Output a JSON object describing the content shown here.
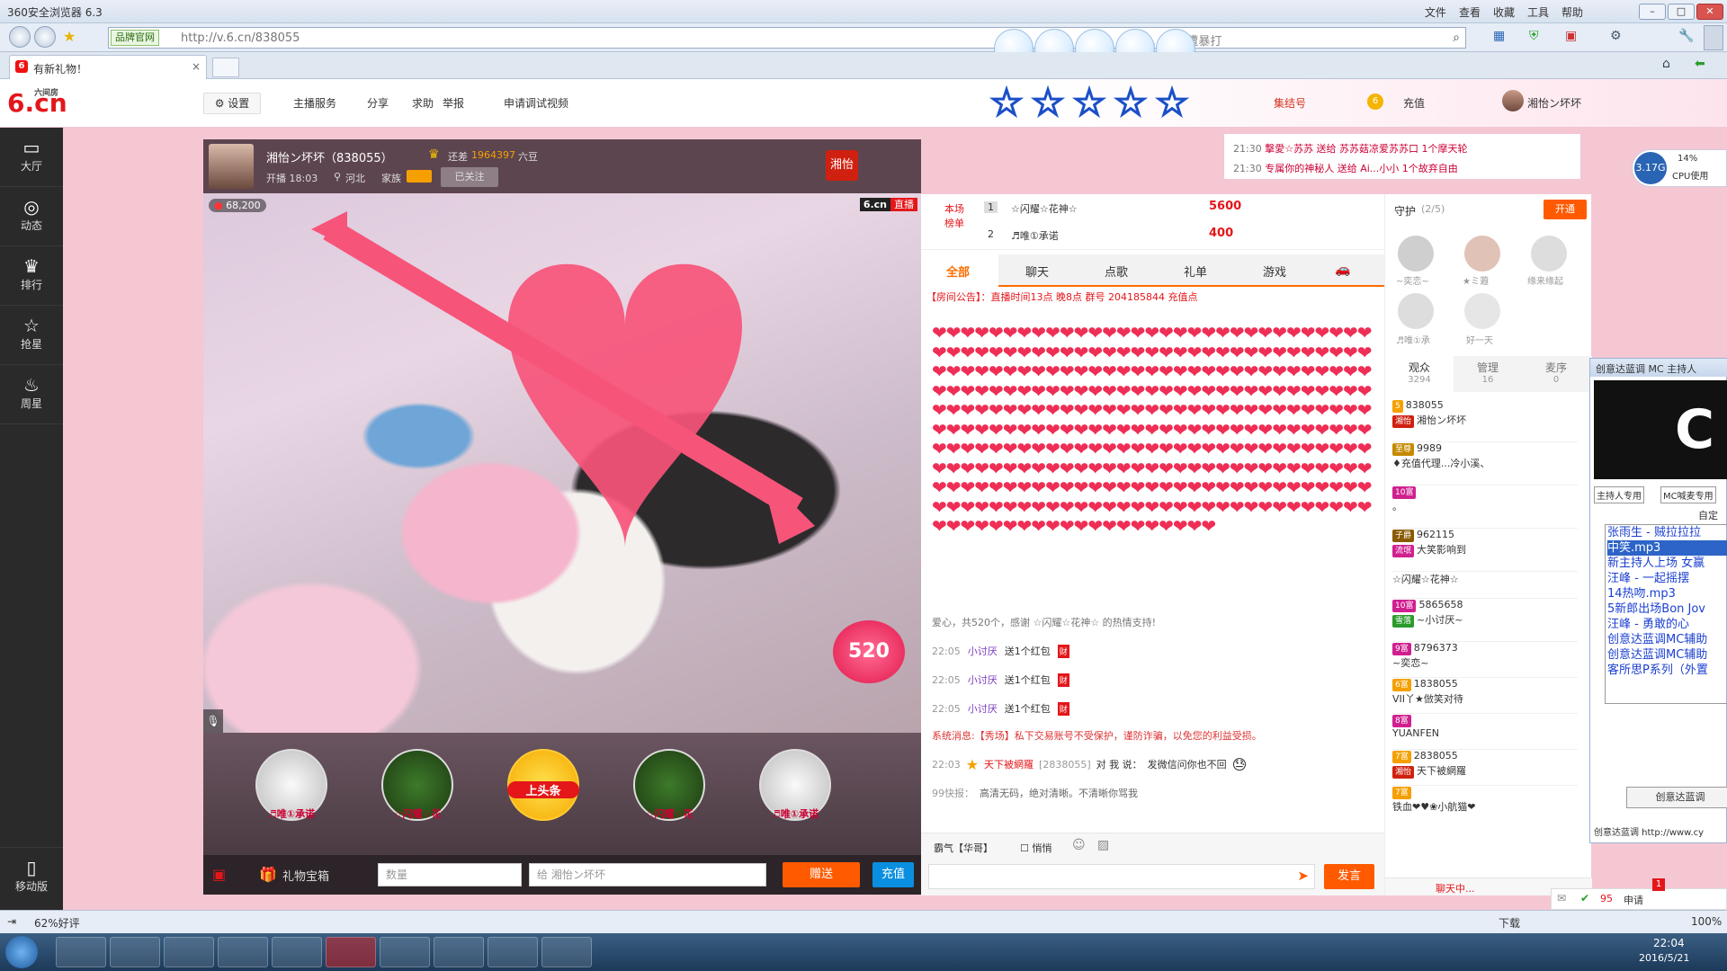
{
  "browser": {
    "title": "360安全浏览器 6.3",
    "menu": [
      "文件",
      "查看",
      "收藏",
      "工具",
      "帮助"
    ],
    "site_tag": "品牌官网",
    "url": "http://v.6.cn/838055",
    "search_text": "...老师遭暴打",
    "tab_label": "有新礼物！",
    "tab_close": "×"
  },
  "site": {
    "logo": "6.cn",
    "logo_sub": "六间房",
    "settings": "设置",
    "nav": [
      "主播服务",
      "分享",
      "求助",
      "举报",
      "申请调试视频"
    ],
    "stars": [
      "★",
      "★",
      "★",
      "★",
      "★"
    ],
    "right_links": [
      "集结号",
      "充值"
    ],
    "user_name": "湘怡ン坏坏"
  },
  "leftnav": [
    {
      "icon": "▭",
      "label": "大厅"
    },
    {
      "icon": "◎",
      "label": "动态"
    },
    {
      "icon": "♛",
      "label": "排行"
    },
    {
      "icon": "☆",
      "label": "抢星"
    },
    {
      "icon": "♨",
      "label": "周星"
    }
  ],
  "leftnav_bottom": "移动版",
  "streamer": {
    "name": "湘怡ン坏坏（838055）",
    "still_short": "还差",
    "beans": "1964397",
    "beans_unit": "六豆",
    "start": "开播 18:03",
    "location": "河北",
    "family": "家族",
    "follow": "已关注",
    "flag": "湘怡",
    "viewers": "68,200",
    "badge": "6.cn",
    "badge_live": "直播",
    "big_heart": "520"
  },
  "gifts": [
    {
      "label": "♬唯①承诺"
    },
    {
      "label": "☆闪耀☆花"
    },
    {
      "label": "上头条"
    },
    {
      "label": "☆闪耀☆花"
    },
    {
      "label": "♬唯①承诺"
    }
  ],
  "giftbar": {
    "box": "礼物宝箱",
    "qty": "数量",
    "to": "给 湘怡ン坏坏",
    "send": "赠送",
    "recharge": "充值"
  },
  "rank": {
    "label": "本场榜单",
    "rows": [
      {
        "no": "1",
        "name": "☆闪耀☆花神☆",
        "score": "5600"
      },
      {
        "no": "2",
        "name": "♬唯①承诺",
        "score": "400"
      }
    ]
  },
  "chat_tabs": [
    "全部",
    "聊天",
    "点歌",
    "礼单",
    "游戏"
  ],
  "notice": "【房间公告】：直播时间13点 晚8点 群号 204185844 充值点",
  "hearts": "❤❤❤❤❤❤❤❤❤❤❤❤❤❤❤❤❤❤❤❤❤❤❤❤❤❤❤❤❤❤❤❤❤❤❤❤❤❤❤❤❤❤❤❤❤❤❤❤❤❤❤❤❤❤❤❤❤❤❤❤❤❤❤❤❤❤❤❤❤❤❤❤❤❤❤❤❤❤❤❤❤❤❤❤❤❤❤❤❤❤❤❤❤❤❤❤❤❤❤❤❤❤❤❤❤❤❤❤❤❤❤❤❤❤❤❤❤❤❤❤❤❤❤❤❤❤❤❤❤❤❤❤❤❤❤❤❤❤❤❤❤❤❤❤❤❤❤❤❤❤❤❤❤❤❤❤❤❤❤❤❤❤❤❤❤❤❤❤❤❤❤❤❤❤❤❤❤❤❤❤❤❤❤❤❤❤❤❤❤❤❤❤❤❤❤❤❤❤❤❤❤❤❤❤❤❤❤❤❤❤❤❤❤❤❤❤❤❤❤❤❤❤❤❤❤❤❤❤❤❤❤❤❤❤❤❤❤❤❤❤❤❤❤❤❤❤❤❤❤❤❤❤❤❤❤❤❤❤❤❤❤❤❤❤❤❤❤❤❤❤❤❤❤❤❤❤❤❤❤❤❤❤❤❤❤❤❤❤❤❤❤❤❤❤❤❤❤❤❤❤❤❤❤❤❤❤❤❤❤❤❤❤❤❤❤❤❤❤❤❤❤❤❤❤❤❤❤❤❤❤",
  "heart_msg": "爱心，共520个，感谢 ☆闪耀☆花神☆ 的热情支持!",
  "chat": [
    {
      "time": "22:05",
      "user": "小讨厌",
      "text": "送1个红包"
    },
    {
      "time": "22:05",
      "user": "小讨厌",
      "text": "送1个红包"
    },
    {
      "time": "22:05",
      "user": "小讨厌",
      "text": "送1个红包"
    }
  ],
  "system_msg": "系统消息:【秀场】私下交易账号不受保护，谨防诈骗，以免您的利益受损。",
  "chat2": {
    "time": "22:03",
    "user": "天下被網羅",
    "id": "[2838055]",
    "to": "对 我 说：",
    "text": "发微信问你也不回"
  },
  "fast": {
    "label": "99快报：",
    "text": "高清无码，绝对清晰。不清晰你骂我"
  },
  "chat_input": {
    "target": "霸气【华哥】",
    "quiet": "悄悄",
    "send": "发言"
  },
  "top_msgs": [
    {
      "time": "21:30",
      "text": "擊愛☆苏苏 送给 苏苏菇凉爱苏苏口 1个摩天轮"
    },
    {
      "time": "21:30",
      "text": "专属你的神秘人 送给 Ai...小小 1个故弃自由"
    }
  ],
  "guard": {
    "title": "守护",
    "count": "(2/5)",
    "open": "开通",
    "members": [
      "~奕恋~",
      "★ミ蕸",
      "缘来缘起",
      "♬唯①承",
      "好一天"
    ]
  },
  "aud_tabs": [
    {
      "label": "观众",
      "n": "3294"
    },
    {
      "label": "管理",
      "n": "16"
    },
    {
      "label": "麦序",
      "n": "0"
    }
  ],
  "audience": [
    {
      "id": "838055",
      "name": "湘怡ン坏坏"
    },
    {
      "id": "9989",
      "name": "♦充值代理...冷小溪、"
    },
    {
      "id": "",
      "name": "。"
    },
    {
      "id": "962115",
      "name": "大笑影响到"
    },
    {
      "id": "",
      "name": "☆闪耀☆花神☆"
    },
    {
      "id": "5865658",
      "name": "~小讨厌~"
    },
    {
      "id": "8796373",
      "name": "~奕恋~"
    },
    {
      "id": "1838055",
      "name": "VII丫★倣笑对待"
    },
    {
      "id": "",
      "name": "YUANFEN"
    },
    {
      "id": "2838055",
      "name": "天下被網羅"
    },
    {
      "id": "",
      "name": "铁血❤♥❀小航猫❤"
    }
  ],
  "aud_footer": {
    "chatting": "聊天中...",
    "count": "95",
    "apply": "申请",
    "badge": "1"
  },
  "cpu": {
    "value": "3.17G",
    "pct": "14%",
    "label": "CPU使用"
  },
  "popup": {
    "title": "创意达蓝调 MC 主持人",
    "tabs": [
      "主持人专用",
      "MC喊麦专用"
    ],
    "sub": "自定",
    "list": [
      "张雨生 - 贼拉拉拉",
      "中笑.mp3",
      "新主持人上场 女赢",
      "汪峰 - 一起摇摆",
      "14热吻.mp3",
      "5新郎出场Bon Jov",
      "汪峰 - 勇敢的心",
      "创意达蓝调MC辅助",
      "创意达蓝调MC辅助",
      "客所思P系列（外置"
    ],
    "btn": "创意达蓝调",
    "footer": "创意达蓝调 http://www.cy"
  },
  "status": {
    "rating": "62%好评",
    "download": "下载",
    "zoom": "100%"
  },
  "clock": {
    "time": "22:04",
    "date": "2016/5/21"
  }
}
